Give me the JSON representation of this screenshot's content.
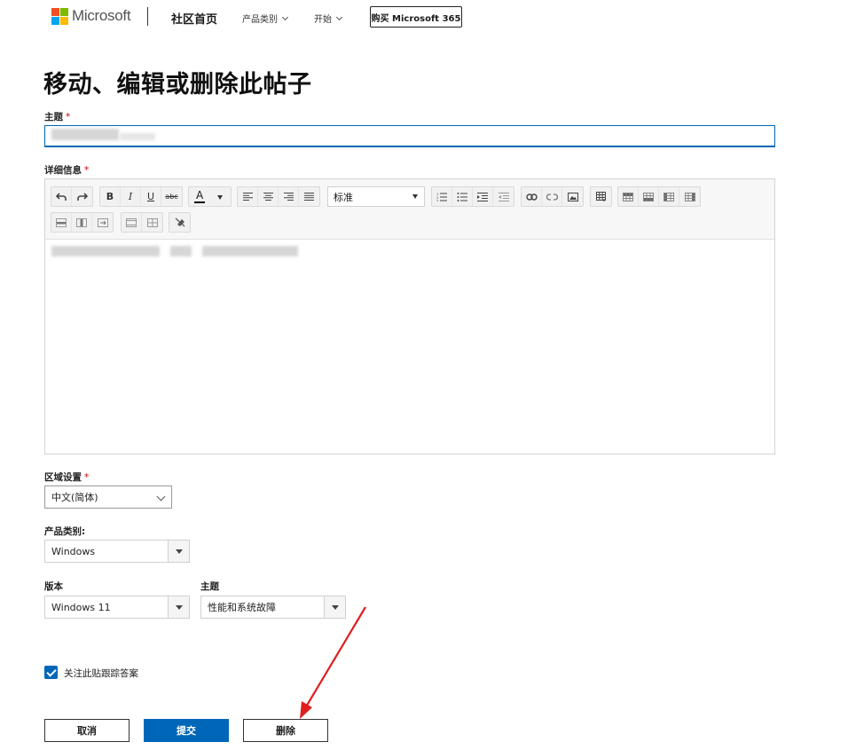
{
  "header": {
    "brand": "Microsoft",
    "home": "社区首页",
    "nav": [
      "产品类别",
      "开始"
    ],
    "buy": "购买 Microsoft 365",
    "logo_colors": [
      "#f25022",
      "#7fba00",
      "#00a4ef",
      "#ffb900"
    ]
  },
  "page": {
    "title": "移动、编辑或删除此帖子"
  },
  "form": {
    "subject_label": "主题",
    "details_label": "详细信息",
    "required_mark": "*",
    "locale_label": "区域设置",
    "locale_value": "中文(简体)",
    "product_label": "产品类别:",
    "product_value": "Windows",
    "version_label": "版本",
    "version_value": "Windows 11",
    "topic_label": "主题",
    "topic_value": "性能和系统故障",
    "follow_label": "关注此贴跟踪答案",
    "follow_checked": true
  },
  "toolbar": {
    "format_value": "标准",
    "bold": "B",
    "italic": "I",
    "underline": "U",
    "strike": "abc",
    "font_color": "A",
    "icons": [
      "undo-icon",
      "redo-icon",
      "align-left-icon",
      "align-center-icon",
      "align-right-icon",
      "justify-icon",
      "numbered-list-icon",
      "bullet-list-icon",
      "indent-icon",
      "outdent-icon",
      "link-icon",
      "unlink-icon",
      "image-icon",
      "table-icon"
    ]
  },
  "buttons": {
    "cancel": "取消",
    "submit": "提交",
    "delete": "删除"
  },
  "colors": {
    "accent": "#0067b8",
    "annotation": "#e01f1f"
  }
}
